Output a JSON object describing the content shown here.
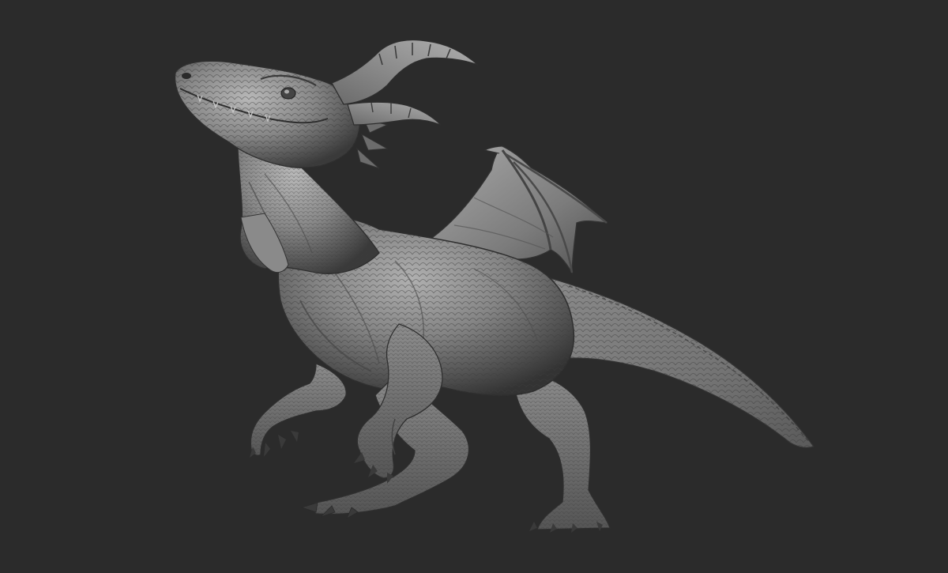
{
  "scene": {
    "subject": "dragon-sculpt",
    "background_color": "#2b2b2b",
    "material_colors": {
      "highlight": "#b4b4b4",
      "mid": "#7e7e7e",
      "shadow": "#3a3a3a",
      "deep": "#242424"
    }
  }
}
